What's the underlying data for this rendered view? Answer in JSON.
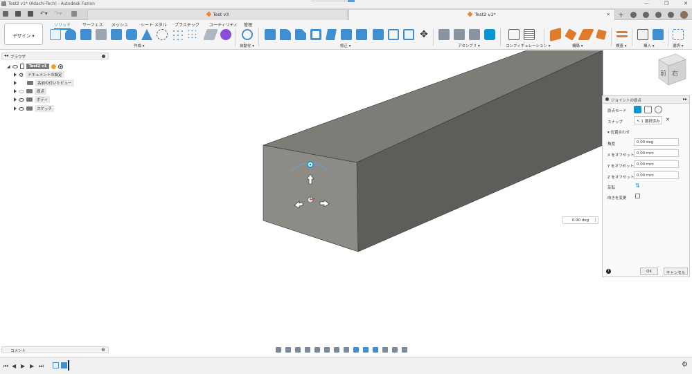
{
  "window": {
    "title": "Test2 v1* (Adachi-Tech) - Autodesk Fusion"
  },
  "tabs": [
    {
      "label": "Test v3",
      "active": false
    },
    {
      "label": "Test2 v1*",
      "active": true
    }
  ],
  "workspace_button": "デザイン ▾",
  "ribbon_tabs": [
    "ソリッド",
    "サーフェス",
    "メッシュ",
    "シート メタル",
    "プラスチック",
    "ユーティリティ",
    "管理"
  ],
  "ribbon_groups": [
    "作成 ▾",
    "自動化 ▾",
    "修正 ▾",
    "アセンブリ ▾",
    "コンフィギュレーション ▾",
    "構築 ▾",
    "検査 ▾",
    "挿入 ▾",
    "選択 ▾"
  ],
  "browser": {
    "header": "ブラウザ",
    "root": "Test2 v1",
    "items": [
      "ドキュメントの設定",
      "名前の付いたビュー",
      "原点",
      "ボディ",
      "スケッチ"
    ]
  },
  "view_cube": {
    "face_front": "前",
    "face_right": "右"
  },
  "angle_input": "0.00 deg",
  "joint_panel": {
    "title": "ジョイントの原点",
    "origin_mode_label": "原点モード",
    "snap_label": "スナップ",
    "snap_value": "1 選択済み",
    "section_alignment": "位置合わせ",
    "angle_label": "角度",
    "angle_value": "0.00 deg",
    "x_offset_label": "X をオフセット",
    "x_offset_value": "0.00 mm",
    "y_offset_label": "Y をオフセット",
    "y_offset_value": "0.00 mm",
    "z_offset_label": "Z をオフセット",
    "z_offset_value": "0.00 mm",
    "flip_label": "反転",
    "change_direction_label": "向きを変更",
    "ok_label": "OK",
    "cancel_label": "キャンセル"
  },
  "comments_label": "コメント",
  "colors": {
    "accent": "#0696d7",
    "body_front": "#8c8b86",
    "body_top": "#7b7a75",
    "body_side": "#5e5d59"
  }
}
